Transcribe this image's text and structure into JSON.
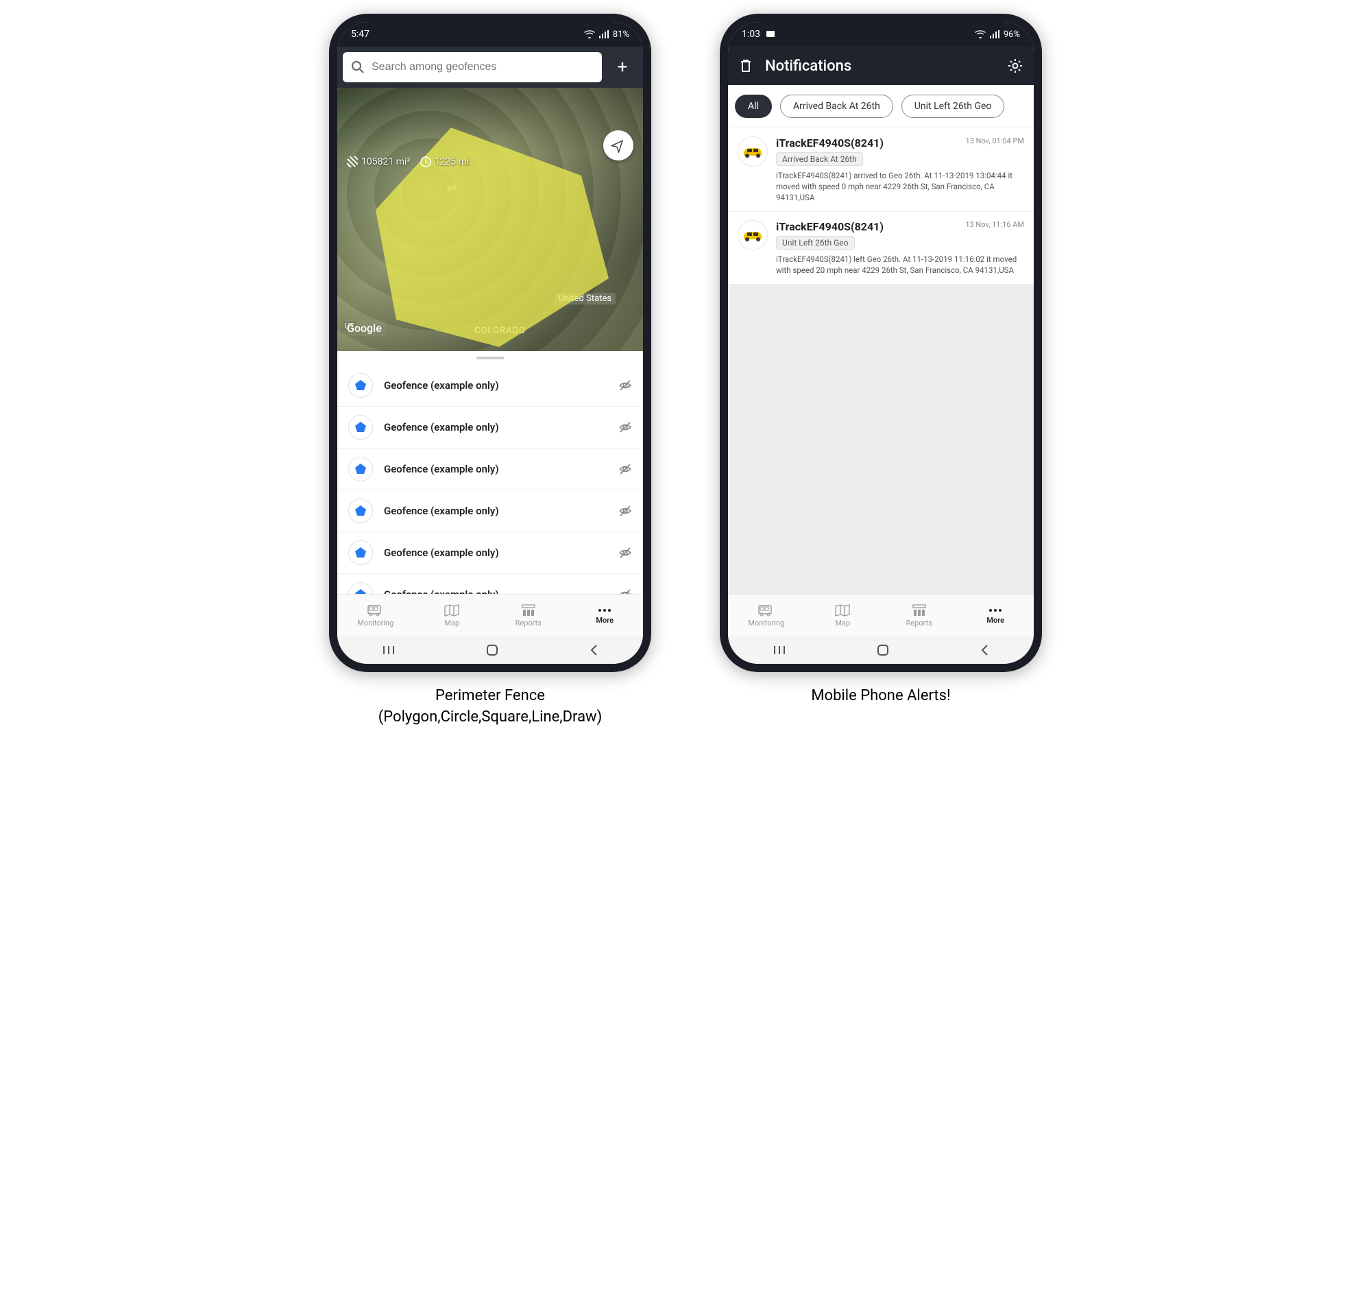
{
  "phone1": {
    "status_time": "5:47",
    "battery": "81%",
    "search_placeholder": "Search among geofences",
    "area_value": "105821 mi²",
    "perimeter_value": "1225 mi",
    "map_labels": {
      "wy": "WY",
      "co": "COLORADO",
      "us": "United States",
      "ut": "UT",
      "google": "Google"
    },
    "geofences": [
      {
        "name": "Geofence (example only)"
      },
      {
        "name": "Geofence (example only)"
      },
      {
        "name": "Geofence (example only)"
      },
      {
        "name": "Geofence (example only)"
      },
      {
        "name": "Geofence (example only)"
      },
      {
        "name": "Geofence (example only)"
      }
    ],
    "tabs": {
      "monitoring": "Monitoring",
      "map": "Map",
      "reports": "Reports",
      "more": "More"
    },
    "caption_line1": "Perimeter Fence",
    "caption_line2": "(Polygon,Circle,Square,Line,Draw)"
  },
  "phone2": {
    "status_time": "1:03",
    "battery": "96%",
    "header_title": "Notifications",
    "chips": {
      "all": "All",
      "c1": "Arrived Back At 26th",
      "c2": "Unit Left 26th Geo"
    },
    "notifs": [
      {
        "name": "iTrackEF4940S(8241)",
        "time": "13 Nov, 01:04 PM",
        "tag": "Arrived Back At 26th",
        "desc": "iTrackEF4940S(8241) arrived to Geo 26th.    At 11-13-2019 13:04:44 it moved with speed 0 mph near 4229 26th St, San Francisco, CA 94131,USA"
      },
      {
        "name": "iTrackEF4940S(8241)",
        "time": "13 Nov, 11:16 AM",
        "tag": "Unit Left 26th Geo",
        "desc": "iTrackEF4940S(8241) left Geo 26th.    At 11-13-2019 11:16:02 it moved with speed 20 mph near 4229 26th St, San Francisco, CA 94131,USA"
      }
    ],
    "tabs": {
      "monitoring": "Monitoring",
      "map": "Map",
      "reports": "Reports",
      "more": "More"
    },
    "caption": "Mobile Phone Alerts!"
  }
}
